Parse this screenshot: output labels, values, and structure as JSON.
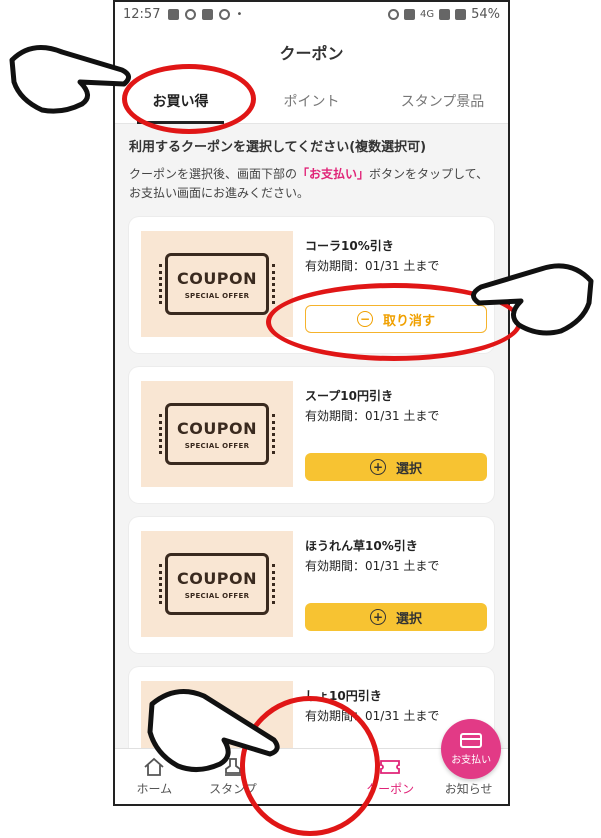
{
  "status": {
    "time": "12:57",
    "network": "4G",
    "battery": "54%"
  },
  "header": {
    "title": "クーポン"
  },
  "tabs": [
    {
      "label": "お買い得",
      "active": true
    },
    {
      "label": "ポイント",
      "active": false
    },
    {
      "label": "スタンプ景品",
      "active": false
    }
  ],
  "instructions": {
    "heading": "利用するクーポンを選択してください(複数選択可)",
    "desc_pre": "クーポンを選択後、画面下部の",
    "desc_highlight": "「お支払い」",
    "desc_post": "ボタンをタップして、お支払い画面にお進みください。"
  },
  "coupons": [
    {
      "name": "コーラ10%引き",
      "expiry": "有効期間：01/31 土まで",
      "button": "取り消す",
      "state": "selected",
      "thumb_title": "COUPON",
      "thumb_sub": "SPECIAL OFFER"
    },
    {
      "name": "スープ10円引き",
      "expiry": "有効期間：01/31 土まで",
      "button": "選択",
      "state": "unselected",
      "thumb_title": "COUPON",
      "thumb_sub": "SPECIAL OFFER"
    },
    {
      "name": "ほうれん草10%引き",
      "expiry": "有効期間：01/31 土まで",
      "button": "選択",
      "state": "unselected",
      "thumb_title": "COUPON",
      "thumb_sub": "SPECIAL OFFER"
    },
    {
      "name": "しょ10円引き",
      "expiry": "有効期間：01/31 土まで",
      "button": "",
      "state": "partial"
    }
  ],
  "nav": [
    {
      "label": "ホーム",
      "icon": "home-icon"
    },
    {
      "label": "スタンプ",
      "icon": "stamp-icon"
    },
    {
      "label": "お支払い",
      "icon": "card-icon"
    },
    {
      "label": "クーポン",
      "icon": "ticket-icon",
      "active": true
    },
    {
      "label": "お知らせ",
      "icon": "message-icon"
    }
  ],
  "colors": {
    "accent_pink": "#e02478",
    "select_yellow": "#f7c332",
    "annotation_red": "#e01616"
  }
}
